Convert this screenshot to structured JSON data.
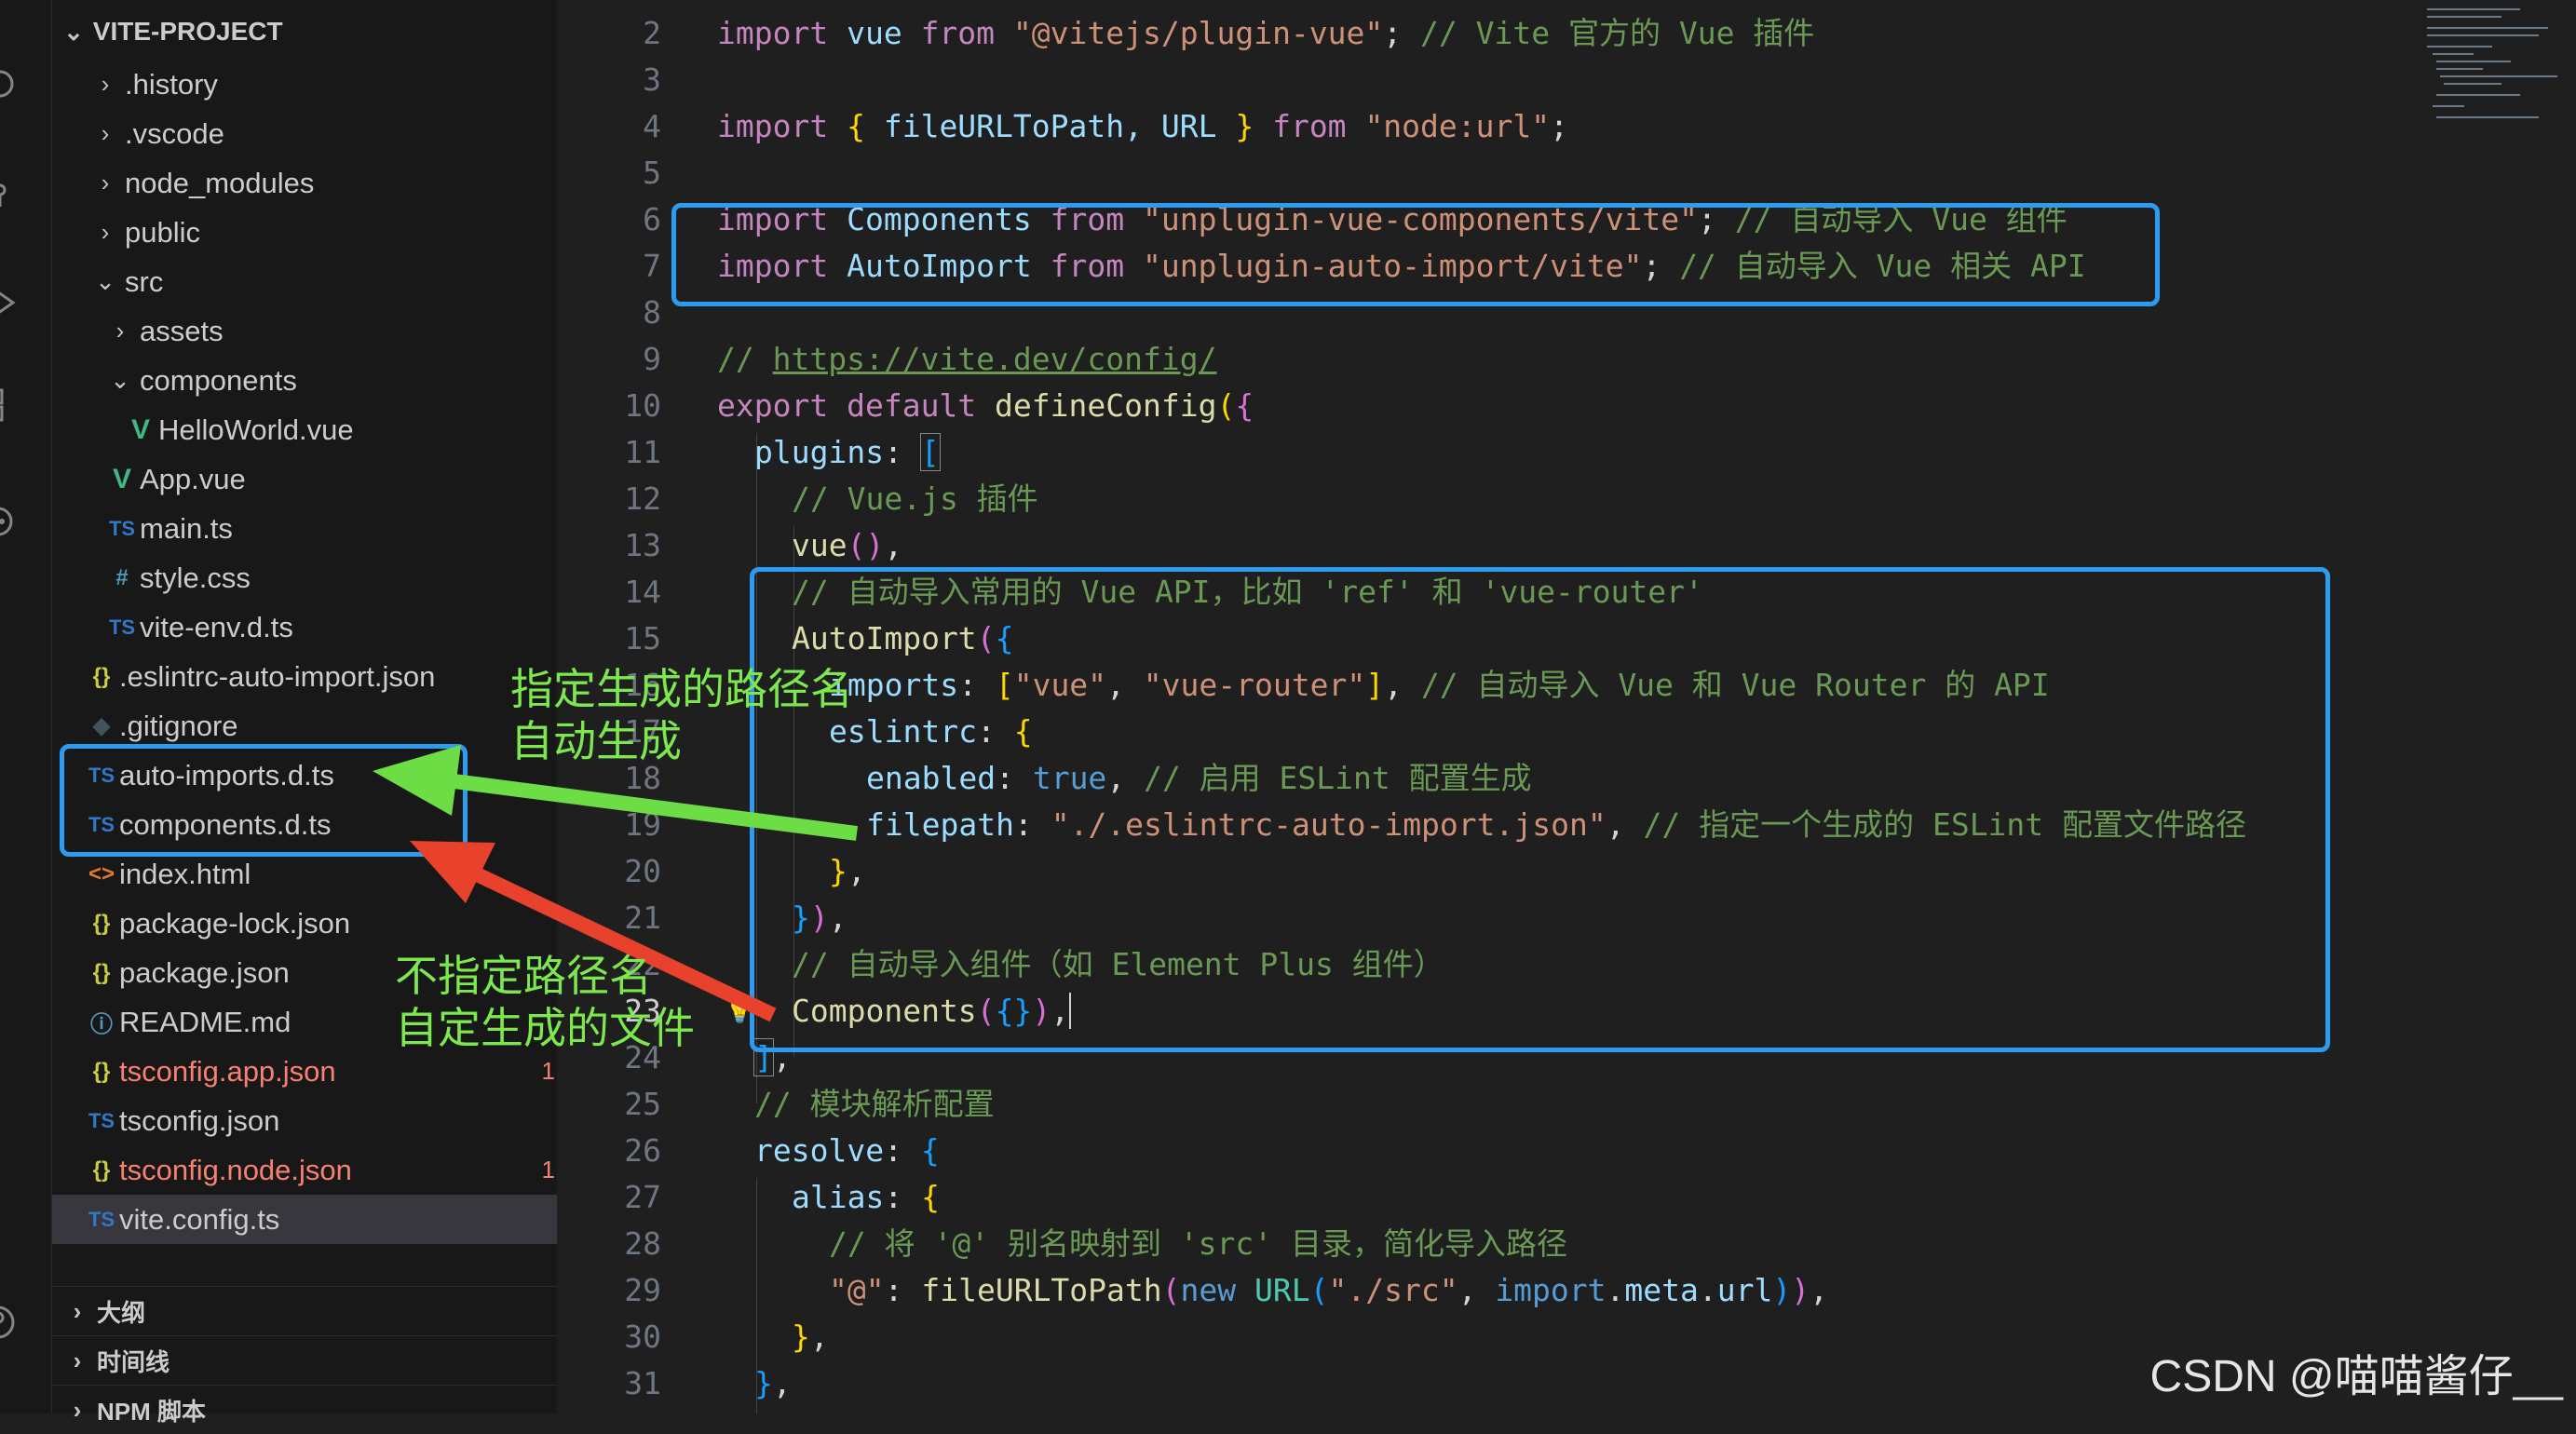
{
  "sidebar": {
    "title": "VITE-PROJECT",
    "items": [
      {
        "label": ".history",
        "chevron": "›",
        "icon": ""
      },
      {
        "label": ".vscode",
        "chevron": "›",
        "icon": ""
      },
      {
        "label": "node_modules",
        "chevron": "›",
        "icon": ""
      },
      {
        "label": "public",
        "chevron": "›",
        "icon": ""
      },
      {
        "label": "src",
        "chevron": "⌄",
        "icon": ""
      },
      {
        "label": "assets",
        "chevron": "›",
        "icon": ""
      },
      {
        "label": "components",
        "chevron": "⌄",
        "icon": ""
      },
      {
        "label": "HelloWorld.vue",
        "chevron": "",
        "icon": "V"
      },
      {
        "label": "App.vue",
        "chevron": "",
        "icon": "V"
      },
      {
        "label": "main.ts",
        "chevron": "",
        "icon": "TS"
      },
      {
        "label": "style.css",
        "chevron": "",
        "icon": "#"
      },
      {
        "label": "vite-env.d.ts",
        "chevron": "",
        "icon": "TS"
      },
      {
        "label": ".eslintrc-auto-import.json",
        "chevron": "",
        "icon": "{}"
      },
      {
        "label": ".gitignore",
        "chevron": "",
        "icon": "◆"
      },
      {
        "label": "auto-imports.d.ts",
        "chevron": "",
        "icon": "TS"
      },
      {
        "label": "components.d.ts",
        "chevron": "",
        "icon": "TS"
      },
      {
        "label": "index.html",
        "chevron": "",
        "icon": "<>"
      },
      {
        "label": "package-lock.json",
        "chevron": "",
        "icon": "{}"
      },
      {
        "label": "package.json",
        "chevron": "",
        "icon": "{}"
      },
      {
        "label": "README.md",
        "chevron": "",
        "icon": "ⓘ"
      },
      {
        "label": "tsconfig.app.json",
        "chevron": "",
        "icon": "{}",
        "badge": "1"
      },
      {
        "label": "tsconfig.json",
        "chevron": "",
        "icon": "TS"
      },
      {
        "label": "tsconfig.node.json",
        "chevron": "",
        "icon": "{}",
        "badge": "1"
      },
      {
        "label": "vite.config.ts",
        "chevron": "",
        "icon": "TS"
      }
    ],
    "sections": [
      "大纲",
      "时间线",
      "NPM 脚本"
    ]
  },
  "editor": {
    "line_numbers": [
      "2",
      "3",
      "4",
      "5",
      "6",
      "7",
      "8",
      "9",
      "10",
      "11",
      "12",
      "13",
      "14",
      "15",
      "16",
      "17",
      "18",
      "19",
      "20",
      "21",
      "22",
      "23",
      "24",
      "25",
      "26",
      "27",
      "28",
      "29",
      "30",
      "31"
    ]
  },
  "code": {
    "l2": [
      "import",
      " vue ",
      "from",
      " ",
      "\"@vitejs/plugin-vue\"",
      "; ",
      "// Vite 官方的 Vue 插件"
    ],
    "l4": [
      "import",
      " ",
      "{",
      " fileURLToPath, URL ",
      "}",
      " ",
      "from",
      " ",
      "\"node:url\"",
      ";"
    ],
    "l6": [
      "import",
      " Components ",
      "from",
      " ",
      "\"unplugin-vue-components/vite\"",
      "; ",
      "// 自动导入 Vue 组件"
    ],
    "l7": [
      "import",
      " AutoImport ",
      "from",
      " ",
      "\"unplugin-auto-import/vite\"",
      "; ",
      "// 自动导入 Vue 相关 API"
    ],
    "l9": [
      "// ",
      "https://vite.dev/config/"
    ],
    "l10": [
      "export",
      " ",
      "default",
      " ",
      "defineConfig",
      "(",
      "{"
    ],
    "l11": [
      "plugins",
      ": ",
      "["
    ],
    "l12": [
      "// Vue.js 插件"
    ],
    "l13": [
      "vue",
      "()",
      ","
    ],
    "l14": [
      "// 自动导入常用的 Vue API，比如 'ref' 和 'vue-router'"
    ],
    "l15": [
      "AutoImport",
      "(",
      "{"
    ],
    "l16": [
      "imports",
      ": ",
      "[",
      "\"vue\"",
      ", ",
      "\"vue-router\"",
      "]",
      ", ",
      "// 自动导入 Vue 和 Vue Router 的 API"
    ],
    "l17": [
      "eslintrc",
      ": ",
      "{"
    ],
    "l18": [
      "enabled",
      ": ",
      "true",
      ", ",
      "// 启用 ESLint 配置生成"
    ],
    "l19": [
      "filepath",
      ": ",
      "\"./.eslintrc-auto-import.json\"",
      ", ",
      "// 指定一个生成的 ESLint 配置文件路径"
    ],
    "l20": [
      "}",
      ","
    ],
    "l21": [
      "}",
      ")",
      ","
    ],
    "l22": [
      "// 自动导入组件（如 Element Plus 组件）"
    ],
    "l23": [
      "Components",
      "(",
      "{}",
      ")",
      ","
    ],
    "l24": [
      "]",
      ","
    ],
    "l25": [
      "// 模块解析配置"
    ],
    "l26": [
      "resolve",
      ": ",
      "{"
    ],
    "l27": [
      "alias",
      ": ",
      "{"
    ],
    "l28": [
      "// 将 '@' 别名映射到 'src' 目录，简化导入路径"
    ],
    "l29": [
      "\"@\"",
      ": ",
      "fileURLToPath",
      "(",
      "new",
      " ",
      "URL",
      "(",
      "\"./src\"",
      ", ",
      "import",
      ".",
      "meta",
      ".",
      "url",
      ")",
      ")",
      ","
    ],
    "l30": [
      "}",
      ","
    ],
    "l31": [
      "}",
      ","
    ]
  },
  "annotations": {
    "green_line1": "指定生成的路径名",
    "green_line2": "自动生成",
    "red_line1": "不指定路径名",
    "red_line2": "自定生成的文件"
  },
  "colors": {
    "box": "#2d9cf0",
    "green_arrow": "#6ddd46",
    "red_arrow": "#e8412c"
  },
  "watermark": "CSDN @喵喵酱仔__"
}
